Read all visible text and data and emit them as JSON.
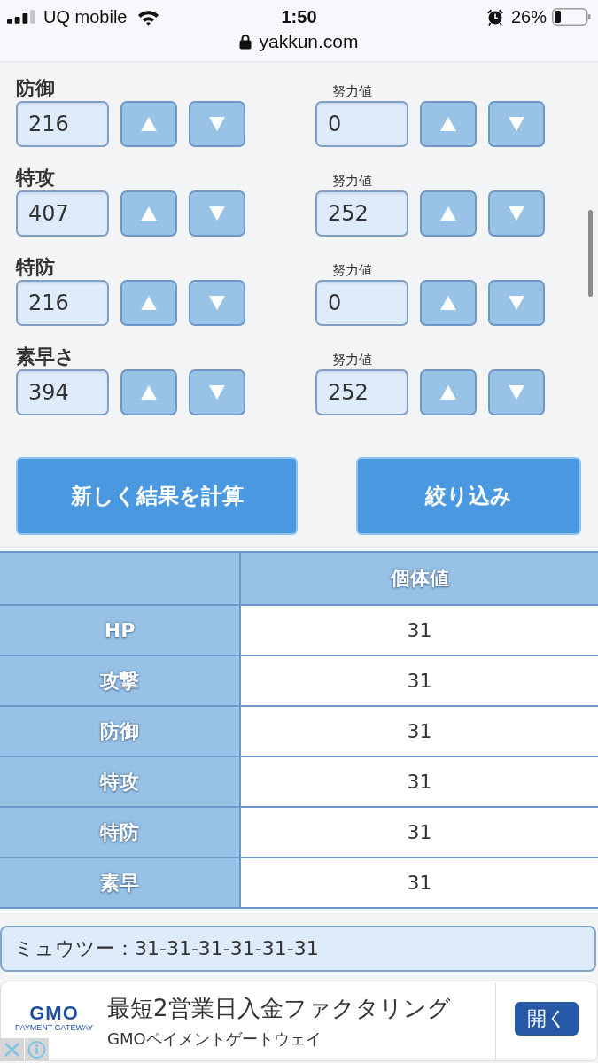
{
  "status_bar": {
    "carrier": "UQ mobile",
    "time": "1:50",
    "battery": "26%"
  },
  "address_bar": {
    "url": "yakkun.com"
  },
  "stats": [
    {
      "label": "防御",
      "value": "216",
      "ev_label": "努力値",
      "ev_value": "0"
    },
    {
      "label": "特攻",
      "value": "407",
      "ev_label": "努力値",
      "ev_value": "252"
    },
    {
      "label": "特防",
      "value": "216",
      "ev_label": "努力値",
      "ev_value": "0"
    },
    {
      "label": "素早さ",
      "value": "394",
      "ev_label": "努力値",
      "ev_value": "252"
    }
  ],
  "actions": [
    "新しく結果を計算",
    "絞り込み"
  ],
  "table": {
    "header": "個体値",
    "rows": [
      {
        "stat": "HP",
        "iv": "31"
      },
      {
        "stat": "攻撃",
        "iv": "31"
      },
      {
        "stat": "防御",
        "iv": "31"
      },
      {
        "stat": "特攻",
        "iv": "31"
      },
      {
        "stat": "特防",
        "iv": "31"
      },
      {
        "stat": "素早",
        "iv": "31"
      }
    ]
  },
  "result": "ミュウツー：31-31-31-31-31-31",
  "ad": {
    "logo": "GMO",
    "logo_tagline": "PAYMENT GATEWAY",
    "title": "最短2営業日入金ファクタリング",
    "advertiser": "GMOペイメントゲートウェイ",
    "button": "開く"
  }
}
